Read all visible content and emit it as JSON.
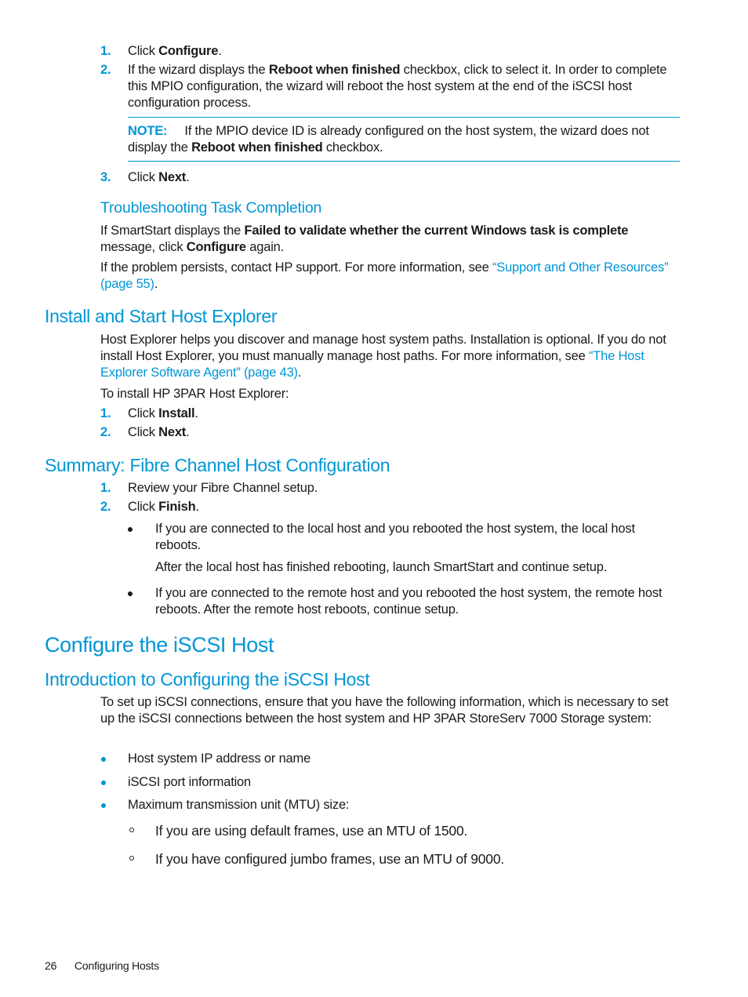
{
  "colors": {
    "accent": "#0096d6",
    "text": "#1a1a1a"
  },
  "step_list_1": [
    {
      "num": "1.",
      "pre": "Click ",
      "bold": "Configure",
      "post": "."
    },
    {
      "num": "2.",
      "pre": "If the wizard displays the ",
      "bold": "Reboot when finished",
      "post": " checkbox, click to select it. In order to complete this MPIO configuration, the wizard will reboot the host system at the end of the iSCSI host configuration process."
    }
  ],
  "note": {
    "label": "NOTE:",
    "pre": "If the MPIO device ID is already configured on the host system, the wizard does not display the ",
    "bold": "Reboot when finished",
    "post": " checkbox."
  },
  "step_3": {
    "num": "3.",
    "pre": "Click ",
    "bold": "Next",
    "post": "."
  },
  "troubleshooting": {
    "heading": "Troubleshooting Task Completion",
    "p1_pre": "If SmartStart displays the ",
    "p1_bold": "Failed to validate whether the current Windows task is complete",
    "p1_mid": " message, click ",
    "p1_bold2": "Configure",
    "p1_post": " again.",
    "p2_pre": "If the problem persists, contact HP support. For more information, see ",
    "p2_link": "“Support and Other Resources” (page 55)",
    "p2_post": "."
  },
  "install_section": {
    "heading": "Install and Start Host Explorer",
    "p1_pre": "Host Explorer helps you discover and manage host system paths. Installation is optional. If you do not install Host Explorer, you must manually manage host paths. For more information, see ",
    "p1_link": "“The Host Explorer Software Agent” (page 43)",
    "p1_post": ".",
    "p2": "To install HP 3PAR Host Explorer:",
    "steps": [
      {
        "num": "1.",
        "pre": "Click ",
        "bold": "Install",
        "post": "."
      },
      {
        "num": "2.",
        "pre": "Click ",
        "bold": "Next",
        "post": "."
      }
    ]
  },
  "summary_section": {
    "heading": "Summary: Fibre Channel Host Configuration",
    "steps": [
      {
        "num": "1.",
        "pre": "Review your Fibre Channel setup.",
        "bold": "",
        "post": ""
      },
      {
        "num": "2.",
        "pre": "Click ",
        "bold": "Finish",
        "post": "."
      }
    ],
    "bullets": [
      {
        "text": "If you are connected to the local host and you rebooted the host system, the local host reboots.",
        "sub": "After the local host has finished rebooting, launch SmartStart and continue setup."
      },
      {
        "text": "If you are connected to the remote host and you rebooted the host system, the remote host reboots. After the remote host reboots, continue setup.",
        "sub": ""
      }
    ]
  },
  "iscsi_chapter": {
    "title": "Configure the iSCSI Host",
    "intro_heading": "Introduction to Configuring the iSCSI Host",
    "intro_p": "To set up iSCSI connections, ensure that you have the following information, which is necessary to set up the iSCSI connections between the host system and HP 3PAR StoreServ 7000 Storage system:",
    "bullets": [
      "Host system IP address or name",
      "iSCSI port information",
      "Maximum transmission unit (MTU) size:"
    ],
    "sub_bullets": [
      "If you are using default frames, use an MTU of 1500.",
      "If you have configured jumbo frames, use an MTU of 9000."
    ]
  },
  "footer": {
    "page_number": "26",
    "section": "Configuring Hosts"
  }
}
